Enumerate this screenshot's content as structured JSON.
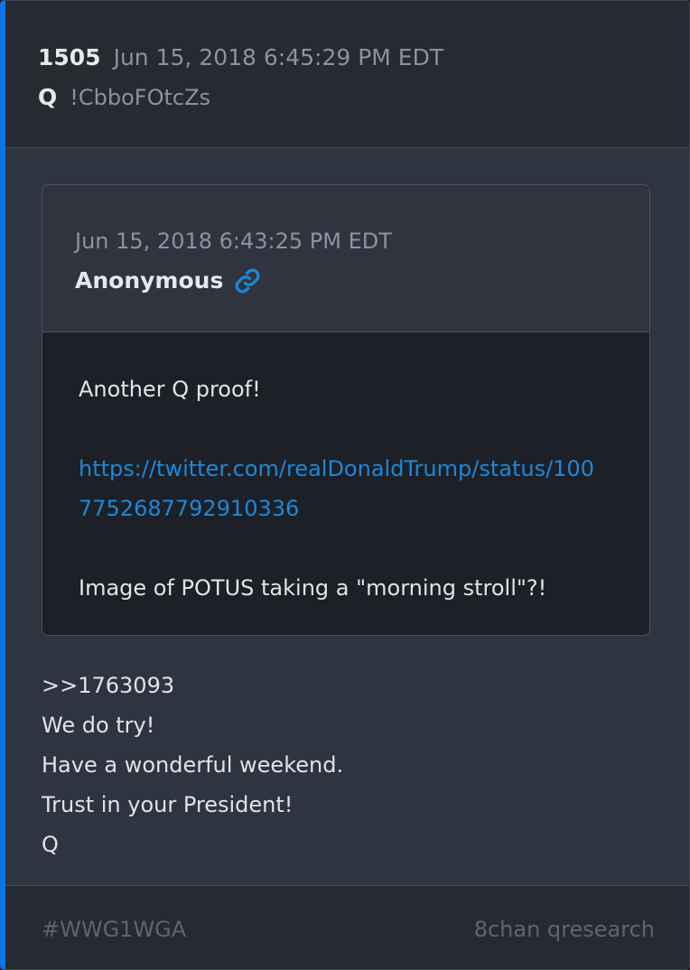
{
  "post": {
    "number": "1505",
    "timestamp": "Jun 15, 2018 6:45:29 PM EDT",
    "author": "Q",
    "tripcode": "!CbboFOtcZs"
  },
  "quoted_post": {
    "timestamp": "Jun 15, 2018 6:43:25 PM EDT",
    "author": "Anonymous",
    "link_icon": "link-icon",
    "body": {
      "line1": "Another Q proof!",
      "link_part1": "https://twitter.com/realDonaldTrump/status/100",
      "link_part2": "7752687792910336",
      "line3": "Image of POTUS taking a \"morning stroll\"?!"
    }
  },
  "reply": {
    "lines": [
      ">>1763093",
      "We do try!",
      "Have a wonderful weekend.",
      "Trust in your President!",
      "Q"
    ]
  },
  "footer": {
    "tag": "#WWG1WGA",
    "source": "8chan qresearch"
  },
  "colors": {
    "accent": "#0d74e8",
    "link": "#1d88d8",
    "card_bg": "#2e3440",
    "quote_bg": "#1d2027"
  }
}
